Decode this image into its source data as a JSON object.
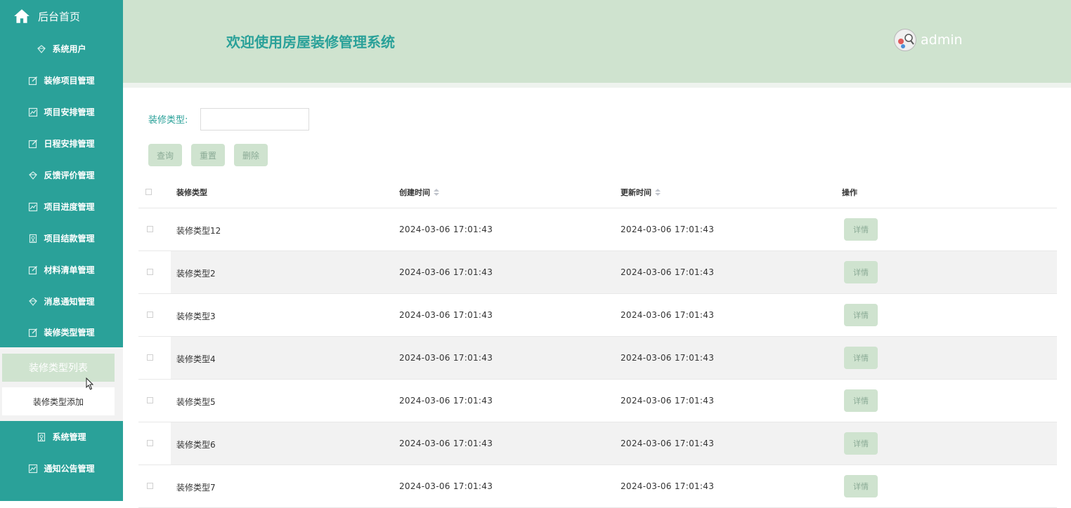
{
  "sidebar": {
    "home_label": "后台首页",
    "items": [
      {
        "label": "系统用户",
        "icon": "diamond-icon"
      },
      {
        "label": "装修项目管理",
        "icon": "edit-icon"
      },
      {
        "label": "项目安排管理",
        "icon": "chart-icon"
      },
      {
        "label": "日程安排管理",
        "icon": "edit-icon"
      },
      {
        "label": "反馈评价管理",
        "icon": "diamond-icon"
      },
      {
        "label": "项目进度管理",
        "icon": "chart-icon"
      },
      {
        "label": "项目结款管理",
        "icon": "badge-icon"
      },
      {
        "label": "材料清单管理",
        "icon": "edit-icon"
      },
      {
        "label": "消息通知管理",
        "icon": "diamond-icon"
      },
      {
        "label": "装修类型管理",
        "icon": "edit-icon"
      },
      {
        "label": "系统管理",
        "icon": "badge-icon"
      },
      {
        "label": "通知公告管理",
        "icon": "chart-icon"
      }
    ],
    "submenu": {
      "active": "装修类型列表",
      "other": "装修类型添加"
    }
  },
  "header": {
    "title": "欢迎使用房屋装修管理系统",
    "username": "admin"
  },
  "search": {
    "label": "装修类型:",
    "value": "",
    "placeholder": ""
  },
  "buttons": {
    "query": "查询",
    "reset": "重置",
    "delete": "删除"
  },
  "table": {
    "columns": [
      "装修类型",
      "创建时间",
      "更新时间",
      "操作"
    ],
    "detail_label": "详情",
    "rows": [
      {
        "type": "装修类型12",
        "created": "2024-03-06 17:01:43",
        "updated": "2024-03-06 17:01:43"
      },
      {
        "type": "装修类型2",
        "created": "2024-03-06 17:01:43",
        "updated": "2024-03-06 17:01:43"
      },
      {
        "type": "装修类型3",
        "created": "2024-03-06 17:01:43",
        "updated": "2024-03-06 17:01:43"
      },
      {
        "type": "装修类型4",
        "created": "2024-03-06 17:01:43",
        "updated": "2024-03-06 17:01:43"
      },
      {
        "type": "装修类型5",
        "created": "2024-03-06 17:01:43",
        "updated": "2024-03-06 17:01:43"
      },
      {
        "type": "装修类型6",
        "created": "2024-03-06 17:01:43",
        "updated": "2024-03-06 17:01:43"
      },
      {
        "type": "装修类型7",
        "created": "2024-03-06 17:01:43",
        "updated": "2024-03-06 17:01:43"
      }
    ]
  },
  "colors": {
    "primary": "#2aa199",
    "light_green": "#cfe3cf",
    "button_text": "#8aaa95"
  }
}
